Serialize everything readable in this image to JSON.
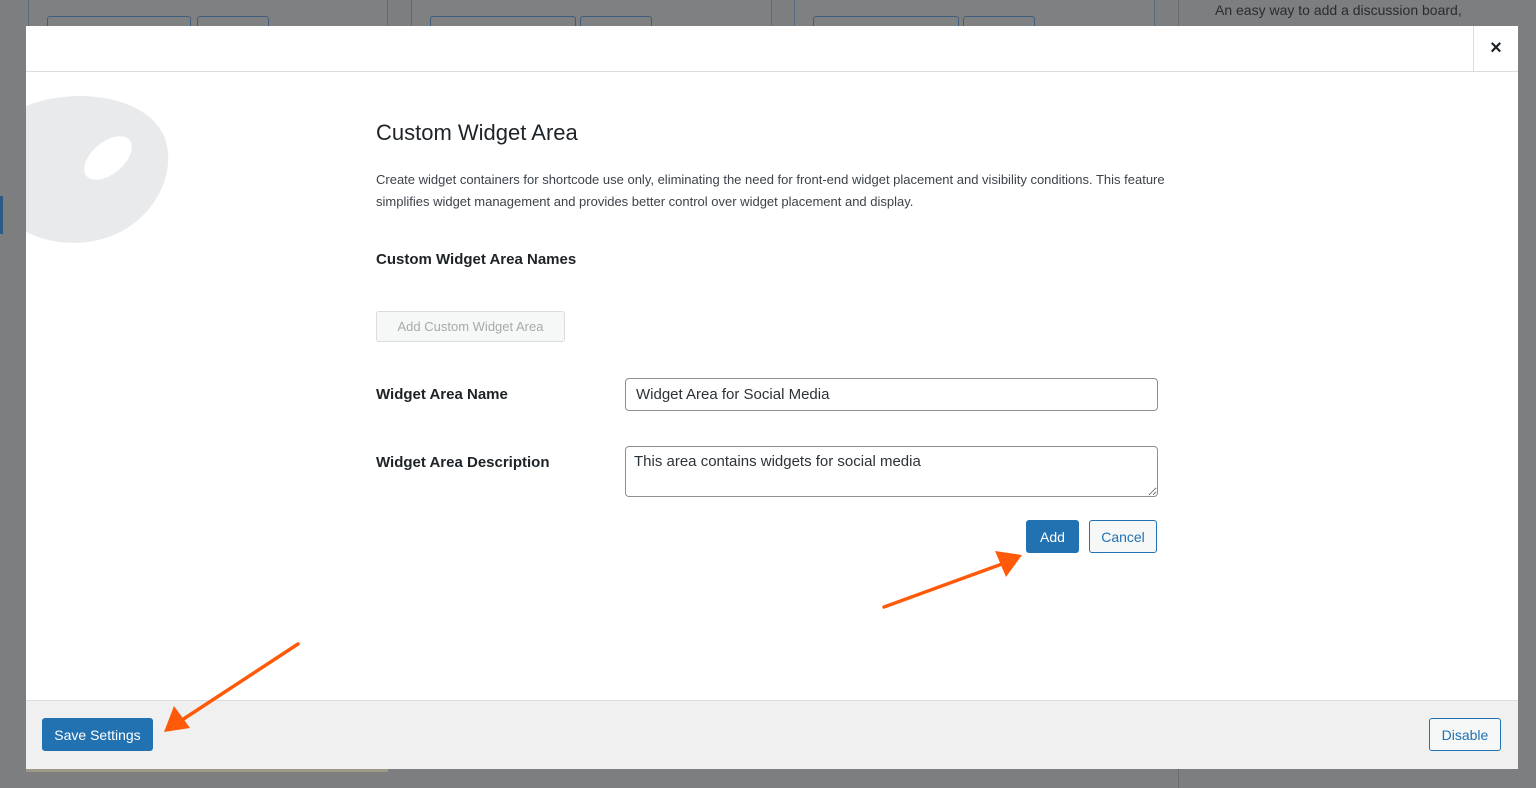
{
  "background": {
    "sidebar_text": "An easy way to add a discussion board,"
  },
  "modal": {
    "close_label": "×",
    "title": "Custom Widget Area",
    "description": "Create widget containers for shortcode use only, eliminating the need for front-end widget placement and visibility conditions. This feature simplifies widget management and provides better control over widget placement and display.",
    "names_heading": "Custom Widget Area Names",
    "add_area_button": "Add Custom Widget Area",
    "form": {
      "name_label": "Widget Area Name",
      "name_value": "Widget Area for Social Media",
      "description_label": "Widget Area Description",
      "description_value": "This area contains widgets for social media",
      "add_button": "Add",
      "cancel_button": "Cancel"
    },
    "footer": {
      "save_button": "Save Settings",
      "disable_button": "Disable"
    }
  },
  "colors": {
    "primary": "#2271b1",
    "annotation_arrow": "#ff5a0a",
    "footer_bg": "#f0f0f1"
  }
}
